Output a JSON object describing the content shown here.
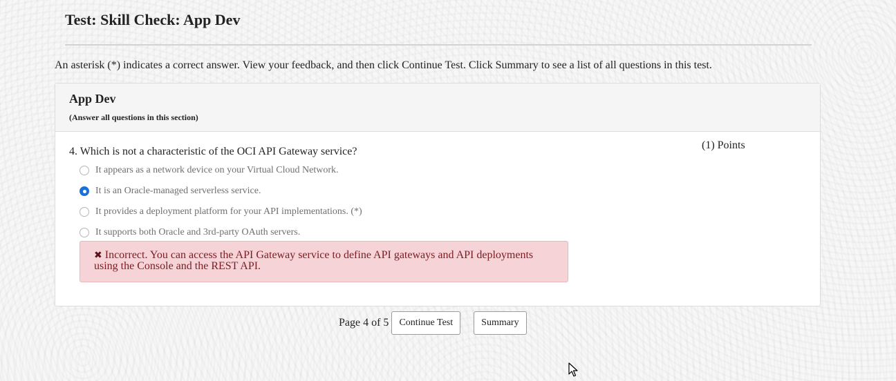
{
  "page": {
    "title": "Test: Skill Check: App Dev",
    "instructions": "An asterisk (*) indicates a correct answer. View your feedback, and then click Continue Test. Click Summary to see a list of all questions in this test."
  },
  "section": {
    "title": "App Dev",
    "note": "(Answer all questions in this section)"
  },
  "question": {
    "text": "4. Which is not a characteristic of the OCI API Gateway service?",
    "points": "(1) Points",
    "options": [
      {
        "label": "It appears as a network device on your Virtual Cloud Network.",
        "selected": false
      },
      {
        "label": "It is an Oracle-managed serverless service.",
        "selected": true
      },
      {
        "label": "It provides a deployment platform for your API implementations. (*)",
        "selected": false
      },
      {
        "label": "It supports both Oracle and 3rd-party OAuth servers.",
        "selected": false
      }
    ],
    "feedback": {
      "icon": "x-icon",
      "text": "Incorrect. You can access the API Gateway service to define API gateways and API deployments using the Console and the REST API."
    }
  },
  "pager": {
    "indicator": "Page 4 of 5",
    "continue_label": "Continue Test",
    "summary_label": "Summary"
  },
  "colors": {
    "selected_radio": "#1a6fd8",
    "feedback_background": "#f6d3d6",
    "feedback_text": "#7a1c22"
  }
}
